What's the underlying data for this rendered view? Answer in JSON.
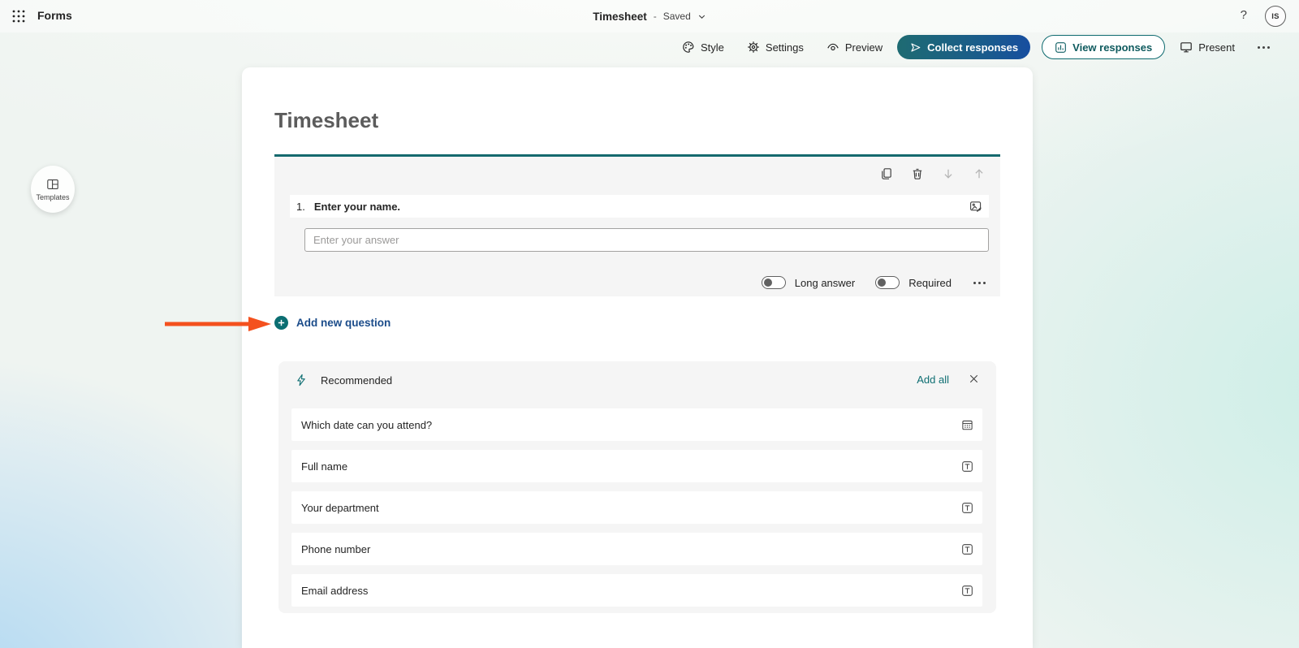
{
  "app": {
    "name": "Forms"
  },
  "header": {
    "doc_title": "Timesheet",
    "separator": "-",
    "saved_status": "Saved",
    "help_label": "?",
    "avatar_initials": "IS"
  },
  "toolbar": {
    "style_label": "Style",
    "settings_label": "Settings",
    "preview_label": "Preview",
    "collect_responses_label": "Collect responses",
    "view_responses_label": "View responses",
    "present_label": "Present"
  },
  "templates_button": {
    "label": "Templates"
  },
  "form": {
    "title": "Timesheet",
    "question": {
      "number": "1.",
      "text": "Enter your name.",
      "answer_placeholder": "Enter your answer",
      "long_answer_label": "Long answer",
      "required_label": "Required"
    },
    "add_new_question_label": "Add new question"
  },
  "recommended": {
    "title": "Recommended",
    "add_all_label": "Add all",
    "items": [
      {
        "label": "Which date can you attend?",
        "icon": "calendar-icon"
      },
      {
        "label": "Full name",
        "icon": "text-field-icon"
      },
      {
        "label": "Your department",
        "icon": "text-field-icon"
      },
      {
        "label": "Phone number",
        "icon": "text-field-icon"
      },
      {
        "label": "Email address",
        "icon": "text-field-icon"
      }
    ]
  },
  "colors": {
    "accent_teal": "#0b6e72",
    "divider_teal": "#15696e",
    "add_link_blue": "#1b4c8a",
    "annotation_orange": "#f4511e",
    "collect_gradient_start": "#1e6b72",
    "collect_gradient_end": "#174ea0"
  }
}
